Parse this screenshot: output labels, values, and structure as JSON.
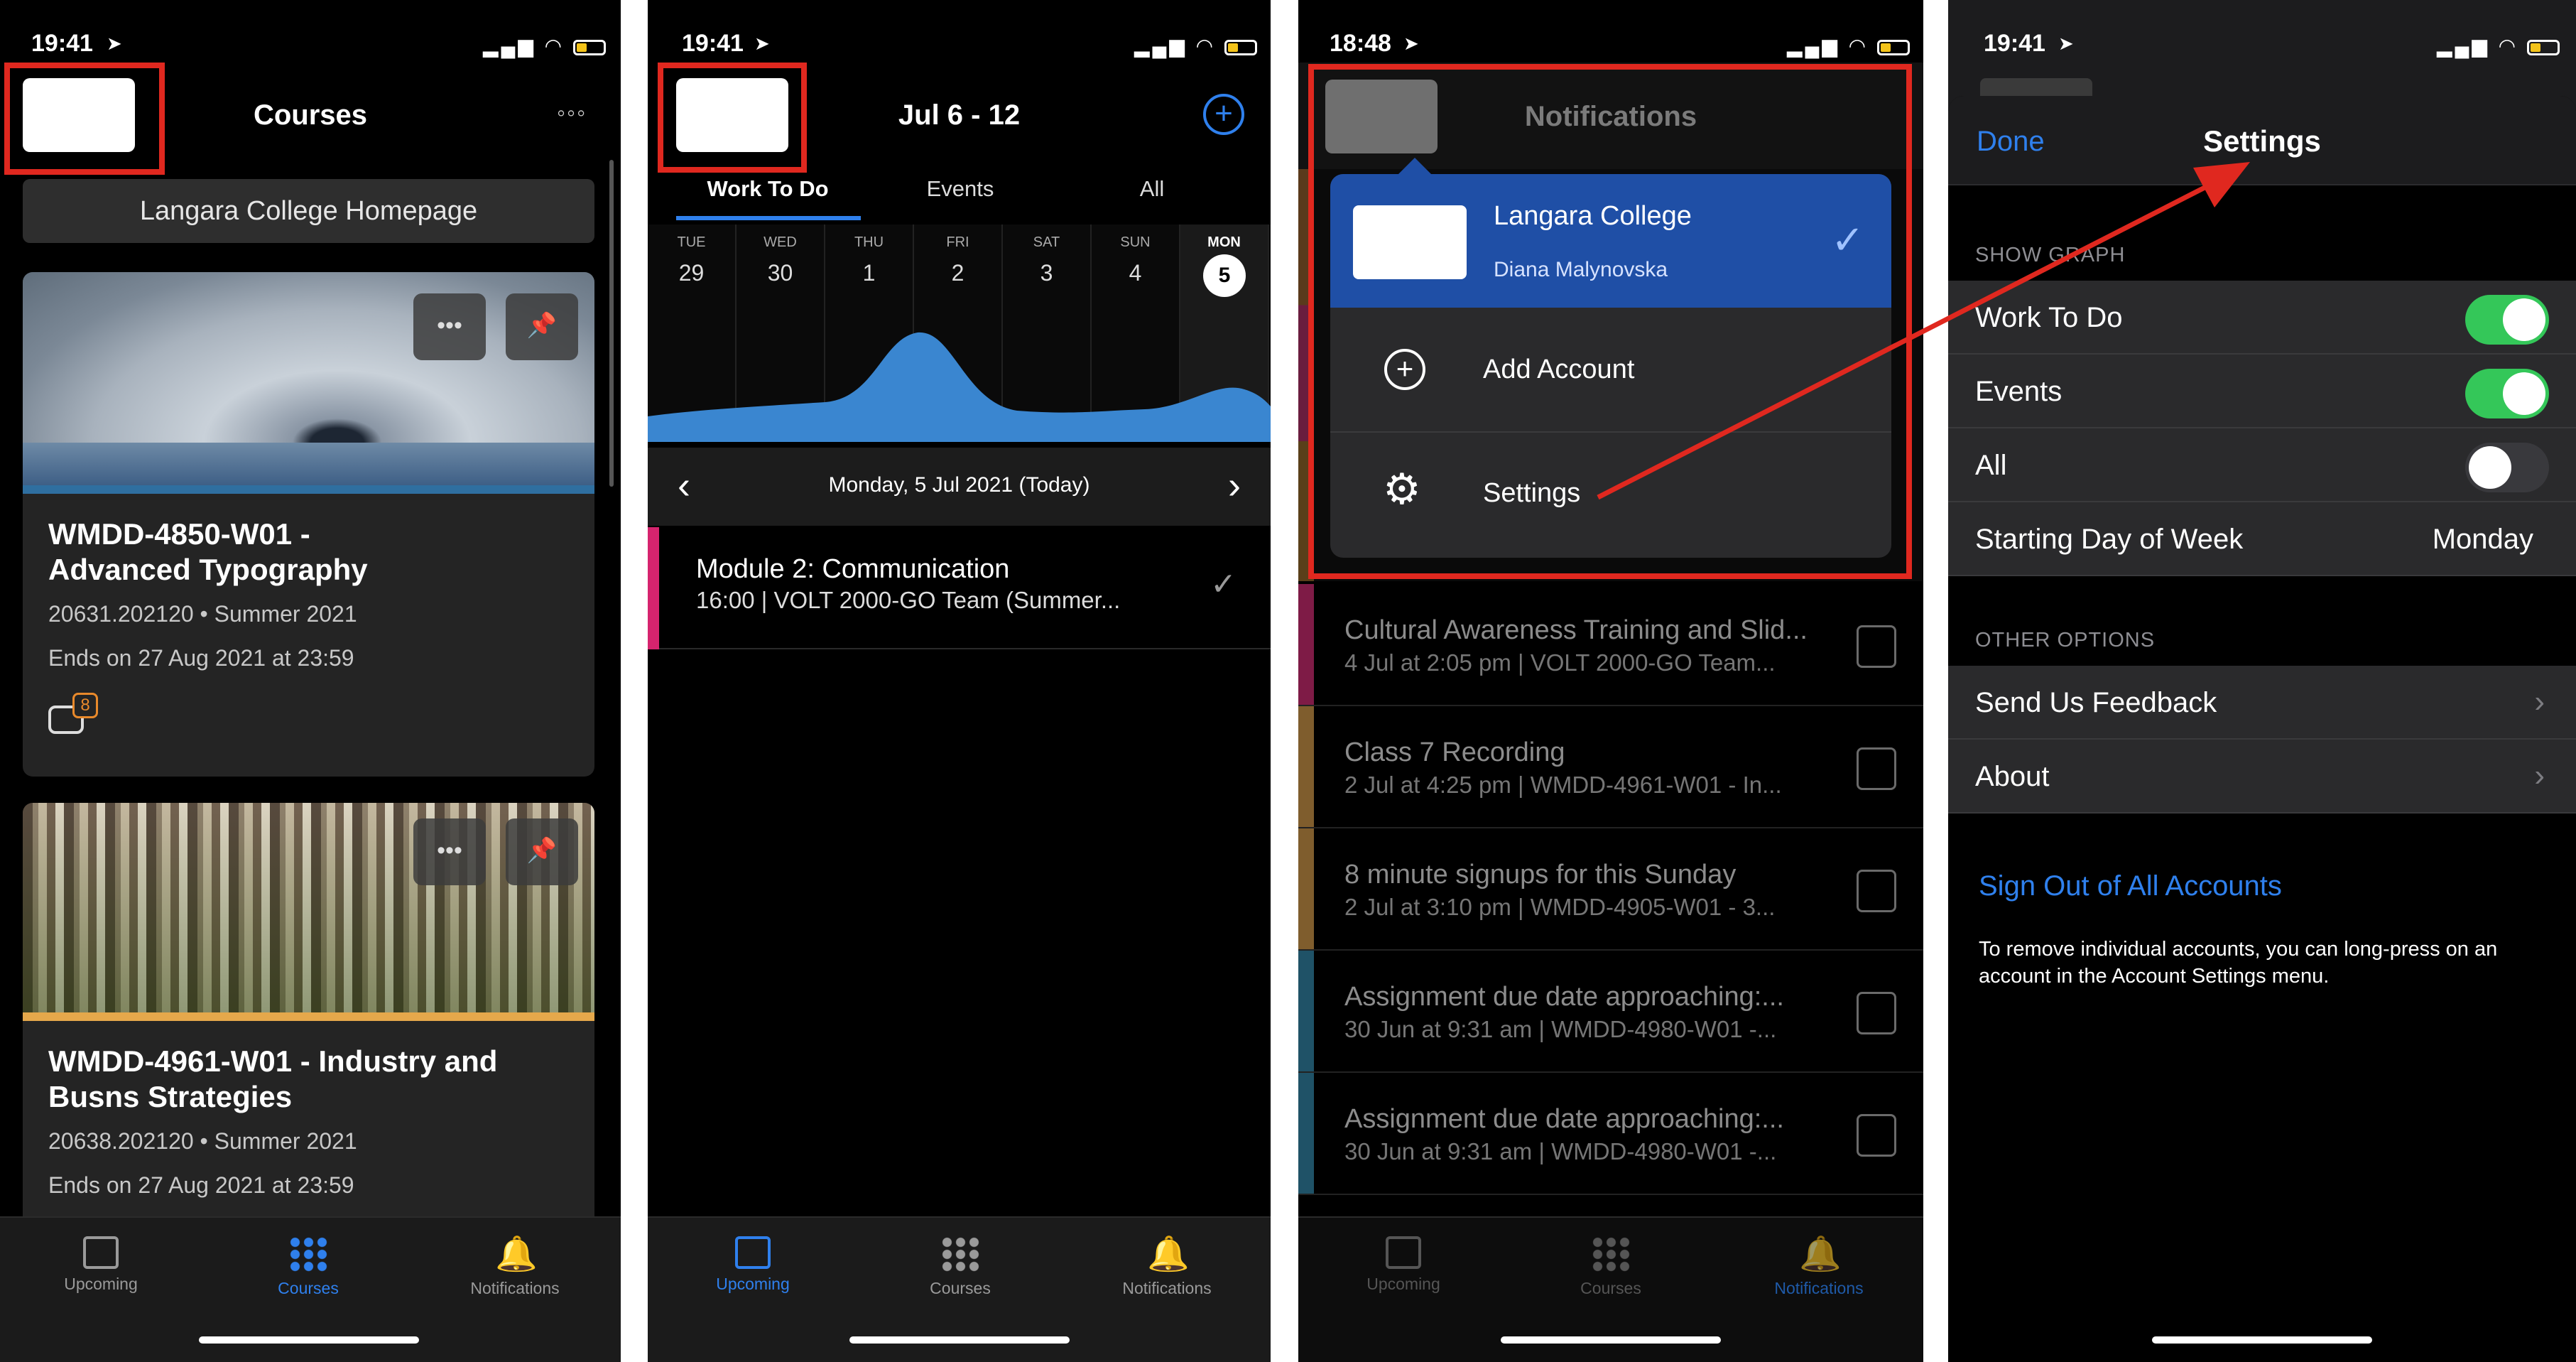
{
  "status": {
    "p1_time": "19:41",
    "p2_time": "19:41",
    "p3_time": "18:48",
    "p4_time": "19:41"
  },
  "courses_screen": {
    "title": "Courses",
    "more_icon": "ellipsis-icon",
    "homepage_button": "Langara College Homepage",
    "cards": [
      {
        "code": "WMDD-4850-W01 -",
        "name": "Advanced Typography",
        "meta": "20631.202120 • Summer 2021",
        "ends": "Ends on 27 Aug 2021 at 23:59",
        "badge": "8",
        "accent": "#2f6fa0"
      },
      {
        "code": "WMDD-4961-W01 - Industry and",
        "name": "Busns Strategies",
        "meta": "20638.202120 • Summer 2021",
        "ends": "Ends on 27 Aug 2021 at 23:59",
        "accent": "#e5a84b"
      }
    ]
  },
  "upcoming_screen": {
    "week_title": "Jul 6 - 12",
    "tabs": [
      "Work To Do",
      "Events",
      "All"
    ],
    "days": [
      {
        "dow": "TUE",
        "num": "29"
      },
      {
        "dow": "WED",
        "num": "30"
      },
      {
        "dow": "THU",
        "num": "1"
      },
      {
        "dow": "FRI",
        "num": "2"
      },
      {
        "dow": "SAT",
        "num": "3"
      },
      {
        "dow": "SUN",
        "num": "4"
      },
      {
        "dow": "MON",
        "num": "5"
      }
    ],
    "date_label": "Monday, 5 Jul 2021 (Today)",
    "item_title": "Module 2: Communication",
    "item_sub": "16:00 | VOLT 2000-GO Team (Summer...",
    "item_accent": "#d6246e"
  },
  "notifications_screen": {
    "title": "Notifications",
    "account_name": "Langara College",
    "account_user": "Diana Malynovska",
    "add_account": "Add Account",
    "settings": "Settings",
    "rows": [
      {
        "title": "Cultural Awareness Training and Slid...",
        "sub": "4 Jul at 2:05 pm | VOLT 2000-GO Team...",
        "color": "#a8245e"
      },
      {
        "title": "Class 7 Recording",
        "sub": "2 Jul at 4:25 pm | WMDD-4961-W01 - In...",
        "color": "#a97c3c"
      },
      {
        "title": "8 minute signups for this Sunday",
        "sub": "2 Jul at 3:10 pm | WMDD-4905-W01 - 3...",
        "color": "#a97c3c"
      },
      {
        "title": "Assignment due date approaching:...",
        "sub": "30 Jun at 9:31 am | WMDD-4980-W01 -...",
        "color": "#2a6e8a"
      },
      {
        "title": "Assignment due date approaching:...",
        "sub": "30 Jun at 9:31 am | WMDD-4980-W01 -...",
        "color": "#2a6e8a"
      }
    ]
  },
  "settings_screen": {
    "done": "Done",
    "title": "Settings",
    "section_graph": "SHOW GRAPH",
    "work_to_do": "Work To Do",
    "events": "Events",
    "all": "All",
    "starting_day_label": "Starting Day of Week",
    "starting_day_value": "Monday",
    "section_other": "OTHER OPTIONS",
    "feedback": "Send Us Feedback",
    "about": "About",
    "sign_out": "Sign Out of All Accounts",
    "footnote": "To remove individual accounts, you can long-press on an account in the Account Settings menu.",
    "toggle_work": true,
    "toggle_events": true,
    "toggle_all": false
  },
  "tabbar": {
    "upcoming": "Upcoming",
    "courses": "Courses",
    "notifications": "Notifications"
  },
  "colors": {
    "accent_blue": "#2f80ed",
    "toggle_on": "#34c759",
    "annotation_red": "#e0281f",
    "graph_blue": "#3a86d0",
    "dropdown_selected": "#1f4fa6"
  }
}
